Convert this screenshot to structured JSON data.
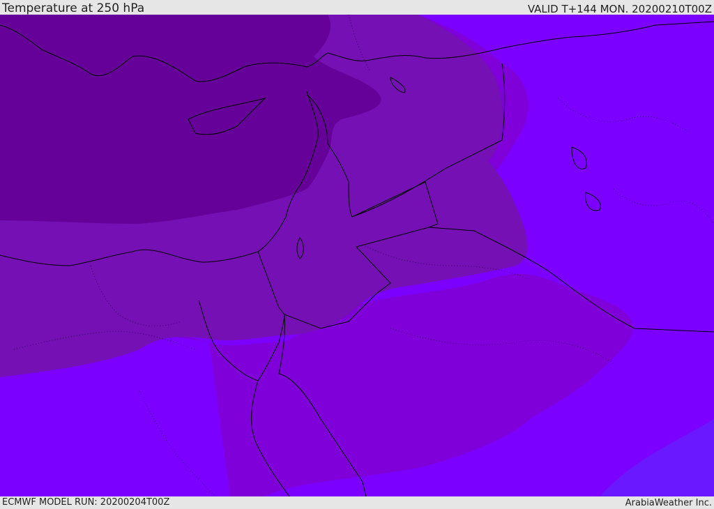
{
  "header": {
    "title": "Temperature at 250 hPa",
    "valid": "VALID T+144 MON. 20200210T00Z"
  },
  "footer": {
    "model_run": "ECMWF MODEL RUN: 20200204T00Z",
    "credit": "ArabiaWeather Inc."
  },
  "colors": {
    "band_coldest": "#650098",
    "band_cold": "#7410b4",
    "band_mid": "#7f00d8",
    "band_warm": "#7b00ff",
    "band_warmest": "#6a18ff",
    "boundaries": "#000000"
  }
}
